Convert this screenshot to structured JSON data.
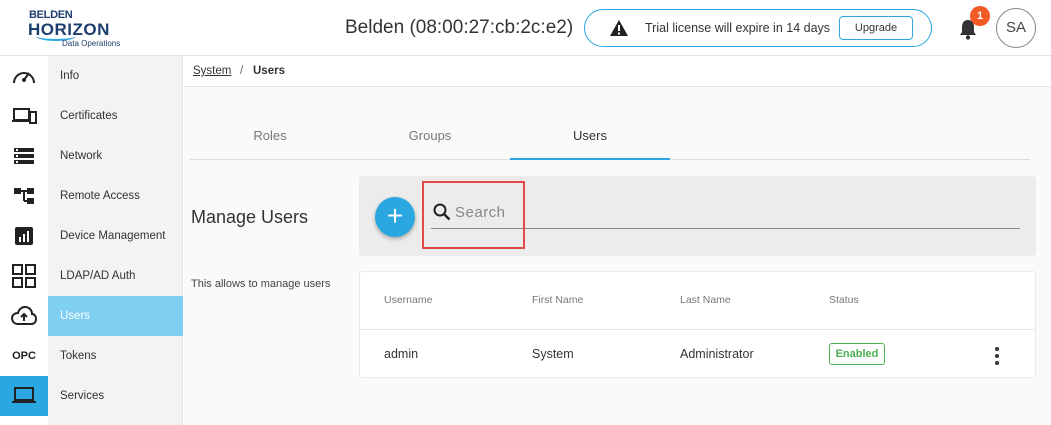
{
  "header": {
    "logo": {
      "line1": "BELDEN",
      "line2": "HORIZON",
      "line3": "Data Operations"
    },
    "device_title": "Belden (08:00:27:cb:2c:e2)",
    "license_message": "Trial license will expire in 14 days",
    "upgrade_label": "Upgrade",
    "notification_count": "1",
    "avatar_initials": "SA"
  },
  "rail": {
    "items": [
      {
        "icon": "dashboard-gauge-icon"
      },
      {
        "icon": "devices-icon"
      },
      {
        "icon": "storage-list-icon"
      },
      {
        "icon": "hierarchy-icon"
      },
      {
        "icon": "analytics-chart-icon"
      },
      {
        "icon": "apps-grid-icon"
      },
      {
        "icon": "cloud-upload-icon"
      },
      {
        "label": "OPC"
      },
      {
        "icon": "laptop-icon",
        "active": true
      }
    ]
  },
  "submenu": {
    "items": [
      {
        "label": "Info"
      },
      {
        "label": "Certificates"
      },
      {
        "label": "Network"
      },
      {
        "label": "Remote Access"
      },
      {
        "label": "Device Management"
      },
      {
        "label": "LDAP/AD Auth"
      },
      {
        "label": "Users",
        "active": true
      },
      {
        "label": "Tokens"
      },
      {
        "label": "Services"
      }
    ]
  },
  "breadcrumb": {
    "parent": "System",
    "separator": "/",
    "current": "Users"
  },
  "tabs": [
    {
      "label": "Roles"
    },
    {
      "label": "Groups"
    },
    {
      "label": "Users",
      "active": true
    }
  ],
  "page": {
    "title": "Manage Users",
    "description": "This allows to manage users"
  },
  "toolbar": {
    "add_label": "+",
    "search_placeholder": "Search",
    "search_value": ""
  },
  "table": {
    "columns": [
      "Username",
      "First Name",
      "Last Name",
      "Status"
    ],
    "rows": [
      {
        "username": "admin",
        "first_name": "System",
        "last_name": "Administrator",
        "status": "Enabled"
      }
    ]
  },
  "colors": {
    "accent": "#2aa7e0",
    "active_submenu": "#7fcff2",
    "badge": "#f15a24",
    "status_enabled": "#4caf50",
    "highlight": "#e04a4a"
  }
}
